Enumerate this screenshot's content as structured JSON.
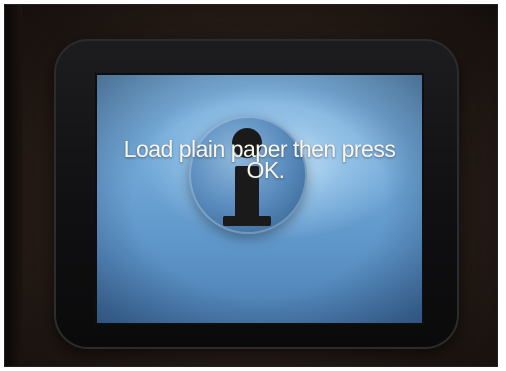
{
  "screen": {
    "message_line_1": "Load plain paper then press",
    "message_line_2": "OK.",
    "icon": "info-icon"
  },
  "colors": {
    "screen_blue": "#6fa6d6",
    "text": "#fbf6e8",
    "bezel": "#101012"
  }
}
